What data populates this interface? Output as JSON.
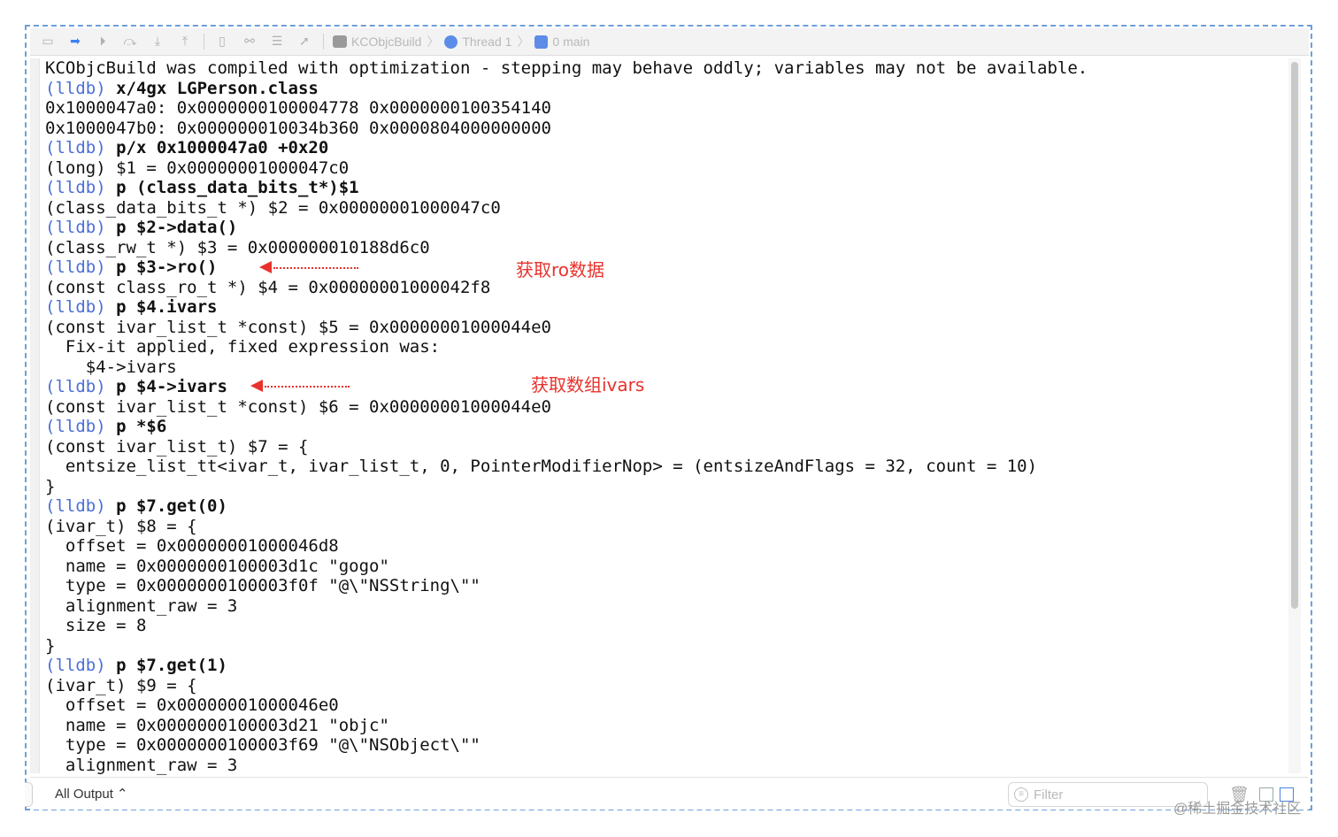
{
  "toolbar": {
    "icons": [
      "panel-icon",
      "breakpoint-icon",
      "continue-icon",
      "step-over-icon",
      "step-into-icon",
      "step-out-icon",
      "view-hierarchy-icon",
      "memory-graph-icon",
      "environment-icon",
      "location-icon"
    ],
    "breadcrumb": {
      "target": "KCObjcBuild",
      "thread": "Thread 1",
      "frame": "0 main"
    }
  },
  "console": {
    "lines": [
      {
        "prompt": "",
        "text": "KCObjcBuild was compiled with optimization - stepping may behave oddly; variables may not be available."
      },
      {
        "prompt": "(lldb)",
        "text": " x/4gx LGPerson.class"
      },
      {
        "prompt": "",
        "text": "0x1000047a0: 0x0000000100004778 0x0000000100354140"
      },
      {
        "prompt": "",
        "text": "0x1000047b0: 0x000000010034b360 0x0000804000000000"
      },
      {
        "prompt": "(lldb)",
        "text": " p/x 0x1000047a0 +0x20"
      },
      {
        "prompt": "",
        "text": "(long) $1 = 0x00000001000047c0"
      },
      {
        "prompt": "(lldb)",
        "text": " p (class_data_bits_t*)$1"
      },
      {
        "prompt": "",
        "text": "(class_data_bits_t *) $2 = 0x00000001000047c0"
      },
      {
        "prompt": "(lldb)",
        "text": " p $2->data()"
      },
      {
        "prompt": "",
        "text": "(class_rw_t *) $3 = 0x000000010188d6c0"
      },
      {
        "prompt": "(lldb)",
        "text": " p $3->ro()"
      },
      {
        "prompt": "",
        "text": "(const class_ro_t *) $4 = 0x00000001000042f8"
      },
      {
        "prompt": "(lldb)",
        "text": " p $4.ivars"
      },
      {
        "prompt": "",
        "text": "(const ivar_list_t *const) $5 = 0x00000001000044e0"
      },
      {
        "prompt": "",
        "text": "  Fix-it applied, fixed expression was:"
      },
      {
        "prompt": "",
        "text": "    $4->ivars"
      },
      {
        "prompt": "(lldb)",
        "text": " p $4->ivars"
      },
      {
        "prompt": "",
        "text": "(const ivar_list_t *const) $6 = 0x00000001000044e0"
      },
      {
        "prompt": "(lldb)",
        "text": " p *$6"
      },
      {
        "prompt": "",
        "text": "(const ivar_list_t) $7 = {"
      },
      {
        "prompt": "",
        "text": "  entsize_list_tt<ivar_t, ivar_list_t, 0, PointerModifierNop> = (entsizeAndFlags = 32, count = 10)"
      },
      {
        "prompt": "",
        "text": "}"
      },
      {
        "prompt": "(lldb)",
        "text": " p $7.get(0)"
      },
      {
        "prompt": "",
        "text": "(ivar_t) $8 = {"
      },
      {
        "prompt": "",
        "text": "  offset = 0x00000001000046d8"
      },
      {
        "prompt": "",
        "text": "  name = 0x0000000100003d1c \"gogo\""
      },
      {
        "prompt": "",
        "text": "  type = 0x0000000100003f0f \"@\\\"NSString\\\"\""
      },
      {
        "prompt": "",
        "text": "  alignment_raw = 3"
      },
      {
        "prompt": "",
        "text": "  size = 8"
      },
      {
        "prompt": "",
        "text": "}"
      },
      {
        "prompt": "(lldb)",
        "text": " p $7.get(1)"
      },
      {
        "prompt": "",
        "text": "(ivar_t) $9 = {"
      },
      {
        "prompt": "",
        "text": "  offset = 0x00000001000046e0"
      },
      {
        "prompt": "",
        "text": "  name = 0x0000000100003d21 \"objc\""
      },
      {
        "prompt": "",
        "text": "  type = 0x0000000100003f69 \"@\\\"NSObject\\\"\""
      },
      {
        "prompt": "",
        "text": "  alignment_raw = 3"
      }
    ]
  },
  "annotations": {
    "ro": "获取ro数据",
    "ivars": "获取数组ivars",
    "color": "#e8322c"
  },
  "bottom": {
    "output_selector": "All Output ⌃",
    "filter_placeholder": "Filter"
  },
  "watermark": "@稀土掘金技术社区"
}
